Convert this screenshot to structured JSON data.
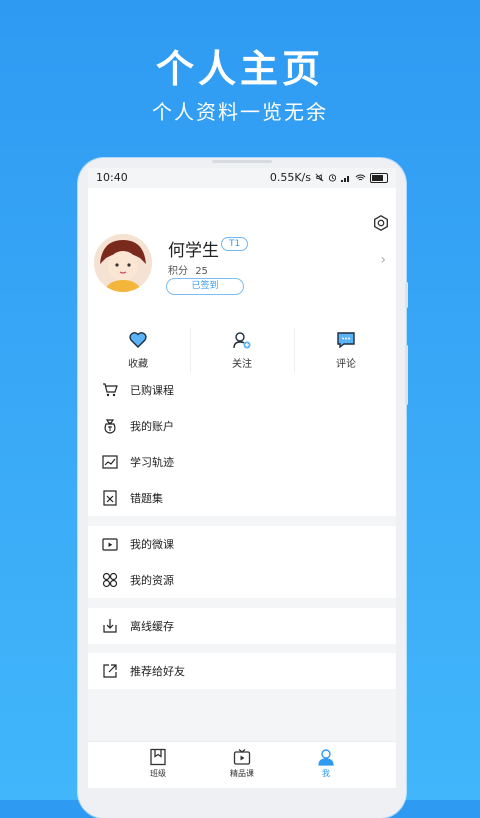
{
  "promo": {
    "title": "个人主页",
    "subtitle": "个人资料一览无余"
  },
  "status_bar": {
    "time": "10:40",
    "network_speed": "0.55K/s"
  },
  "profile": {
    "name": "何学生",
    "level_badge": "T1",
    "points_label": "积分",
    "points_value": "25",
    "checkin_label": "已签到"
  },
  "quick_actions": [
    {
      "label": "收藏",
      "icon": "heart-icon"
    },
    {
      "label": "关注",
      "icon": "follow-user-icon"
    },
    {
      "label": "评论",
      "icon": "comment-icon"
    }
  ],
  "menu_groups": [
    [
      {
        "label": "已购课程",
        "icon": "cart-icon"
      },
      {
        "label": "我的账户",
        "icon": "money-bag-icon"
      }
    ],
    [
      {
        "label": "学习轨迹",
        "icon": "trend-icon"
      },
      {
        "label": "错题集",
        "icon": "wrong-book-icon"
      }
    ],
    [
      {
        "label": "我的微课",
        "icon": "video-icon"
      },
      {
        "label": "我的资源",
        "icon": "grid-icon"
      }
    ],
    [
      {
        "label": "离线缓存",
        "icon": "download-icon"
      }
    ],
    [
      {
        "label": "推荐给好友",
        "icon": "share-icon"
      }
    ]
  ],
  "tab_bar": [
    {
      "label": "班级",
      "icon": "class-icon",
      "active": false
    },
    {
      "label": "精品课",
      "icon": "video-course-icon",
      "active": false
    },
    {
      "label": "我",
      "icon": "person-icon",
      "active": true
    }
  ],
  "colors": {
    "accent": "#2f9af2",
    "background_gradient_top": "#2f9af2",
    "background_gradient_bottom": "#41b6fb"
  }
}
